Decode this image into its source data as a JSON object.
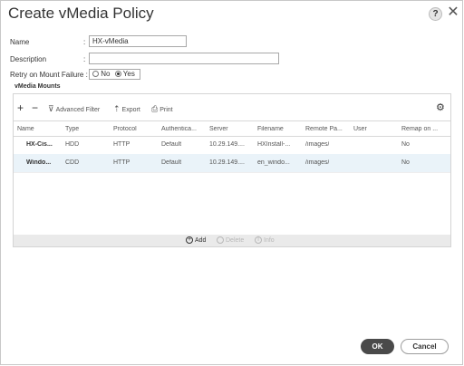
{
  "dialog": {
    "title": "Create vMedia Policy",
    "help_glyph": "?",
    "close_glyph": "✕"
  },
  "form": {
    "name_label": "Name",
    "name_value": "HX-vMedia",
    "description_label": "Description",
    "description_value": "",
    "retry_label": "Retry on Mount Failure :",
    "retry_options": [
      "No",
      "Yes"
    ],
    "retry_selected": "Yes",
    "colon": ":"
  },
  "mounts": {
    "section_title": "vMedia Mounts",
    "toolbar": {
      "add_glyph": "+",
      "remove_glyph": "−",
      "advanced_filter": "Advanced Filter",
      "export": "Export",
      "print": "Print"
    },
    "columns": [
      "Name",
      "Type",
      "Protocol",
      "Authentica...",
      "Server",
      "Filename",
      "Remote Pa...",
      "User",
      "Remap on ..."
    ],
    "rows": [
      [
        "HX-Cis...",
        "HDD",
        "HTTP",
        "Default",
        "10.29.149....",
        "HXInstall-...",
        "/images/",
        "",
        "No"
      ],
      [
        "Windo...",
        "CDD",
        "HTTP",
        "Default",
        "10.29.149....",
        "en_windo...",
        "/images/",
        "",
        "No"
      ]
    ],
    "selected_row": 1,
    "footer": {
      "add": "Add",
      "delete": "Delete",
      "info": "Info"
    }
  },
  "buttons": {
    "ok": "OK",
    "cancel": "Cancel"
  },
  "icons": {
    "help": "help-icon",
    "close": "close-icon",
    "filter": "filter-icon",
    "export": "export-icon",
    "print": "print-icon",
    "settings": "gear-icon"
  }
}
